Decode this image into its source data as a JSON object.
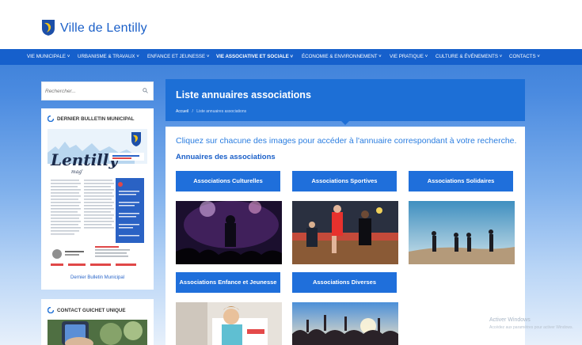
{
  "site": {
    "title": "Ville de Lentilly",
    "brand_color": "#1660cc"
  },
  "nav": {
    "items": [
      {
        "label": "VIE MUNICIPALE ˅"
      },
      {
        "label": "URBANISME & TRAVAUX ˅"
      },
      {
        "label": "ENFANCE ET JEUNESSE ˅"
      },
      {
        "label": "VIE ASSOCIATIVE ET SOCIALE ˅"
      },
      {
        "label": "ÉCONOMIE & ENVIRONNEMENT ˅"
      },
      {
        "label": "VIE PRATIQUE ˅"
      },
      {
        "label": "CULTURE & ÉVÉNEMENTS ˅"
      },
      {
        "label": "CONTACTS ˅"
      }
    ]
  },
  "sidebar": {
    "search": {
      "placeholder": "Rechercher..."
    },
    "bulletin": {
      "title": "DERNIER BULLETIN MUNICIPAL",
      "magazine_name": "Lentilly",
      "magazine_sub": "mag'",
      "caption": "Dernier Bulletin Municipal"
    },
    "contact": {
      "title": "CONTACT GUICHET UNIQUE"
    }
  },
  "main": {
    "title": "Liste annuaires associations",
    "breadcrumb": {
      "home": "Accueil",
      "separator": "/",
      "current": "Liste annuaires associations"
    },
    "intro": "Cliquez sur chacune des images pour accéder à l'annuaire correspondant à votre recherche.",
    "section_title": "Annuaires des associations",
    "categories": [
      {
        "label": "Associations Culturelles",
        "image": "concert-image"
      },
      {
        "label": "Associations Sportives",
        "image": "handball-image"
      },
      {
        "label": "Associations Solidaires",
        "image": "hikers-image"
      },
      {
        "label": "Associations Enfance et Jeunesse",
        "image": "child-image"
      },
      {
        "label": "Associations Diverses",
        "image": "crowd-image"
      }
    ]
  },
  "watermark": {
    "line1": "Activer Windows",
    "line2": "Accédez aux paramètres pour activer Windows."
  }
}
